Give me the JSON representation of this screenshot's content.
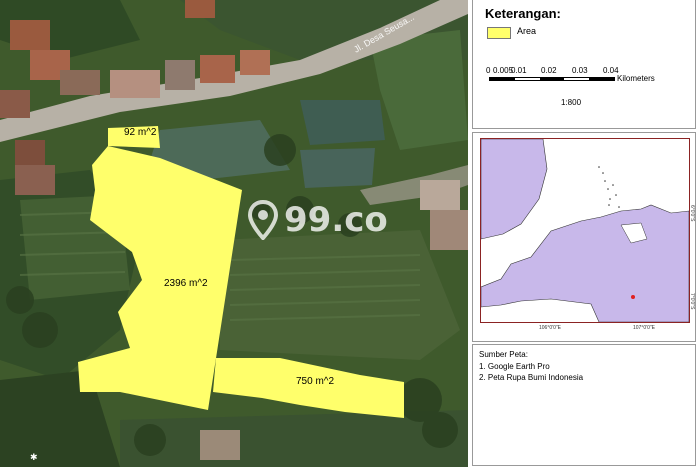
{
  "map": {
    "road_label": "Jl. Desa Seusa...",
    "areas": [
      {
        "label": "92 m^2"
      },
      {
        "label": "2396 m^2"
      },
      {
        "label": "750 m^2"
      }
    ],
    "watermark": "99.co"
  },
  "legend": {
    "title": "Keterangan:",
    "items": [
      {
        "label": "Area",
        "color": "#ffff6b"
      }
    ]
  },
  "scale": {
    "ticks": [
      "0",
      "0.005",
      "0.01",
      "0.02",
      "0.03",
      "0.04"
    ],
    "unit": "Kilometers",
    "ratio": "1:800"
  },
  "inset": {
    "lon_labels": [
      "106°0'0\"E",
      "107°0'0\"E"
    ],
    "lat_labels": [
      "6°0'0\"S",
      "7°0'0\"S"
    ],
    "land_color": "#c8b8ea",
    "marker_color": "#e02020"
  },
  "source": {
    "title": "Sumber Peta:",
    "items": [
      "1. Google Earth Pro",
      "2. Peta Rupa Bumi Indonesia"
    ]
  },
  "colors": {
    "area_fill": "#ffff6b",
    "frame_border": "#8b2323"
  }
}
